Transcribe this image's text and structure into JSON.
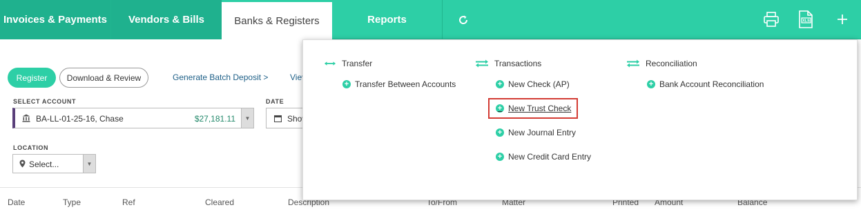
{
  "nav": {
    "tabs": [
      {
        "label": "Invoices & Payments"
      },
      {
        "label": "Vendors & Bills"
      },
      {
        "label": "Banks & Registers"
      },
      {
        "label": "Reports"
      }
    ],
    "active_tab": "Banks & Registers",
    "icons": [
      "refresh-icon",
      "print-icon",
      "xls-export-icon",
      "add-icon"
    ]
  },
  "toolbar": {
    "register_label": "Register",
    "download_label": "Download & Review",
    "batch_link": "Generate Batch Deposit >",
    "view_link_partial": "Viev"
  },
  "filters": {
    "account_label": "SELECT ACCOUNT",
    "account_name": "BA-LL-01-25-16, Chase",
    "account_balance": "$27,181.11",
    "date_label": "DATE",
    "date_value_partial": "Show",
    "location_label": "LOCATION",
    "location_placeholder": "Select..."
  },
  "table": {
    "columns": [
      "Date",
      "Type",
      "Ref",
      "Cleared",
      "Description",
      "To/From",
      "Matter",
      "Printed",
      "Amount",
      "Balance"
    ]
  },
  "menu": {
    "sections": [
      {
        "title": "Transfer",
        "items": [
          "Transfer Between Accounts"
        ]
      },
      {
        "title": "Transactions",
        "items": [
          "New Check (AP)",
          "New Trust Check",
          "New Journal Entry",
          "New Credit Card Entry"
        ]
      },
      {
        "title": "Reconciliation",
        "items": [
          "Bank Account Reconciliation"
        ]
      }
    ],
    "highlighted_item": "New Trust Check"
  },
  "colors": {
    "brand_green": "#2dcfa6",
    "dark_tab_green": "#1fb18e",
    "balance_green": "#22886a",
    "link_blue": "#1d5f87",
    "highlight_red": "#d33b33",
    "account_accent_purple": "#5a3f7a"
  }
}
